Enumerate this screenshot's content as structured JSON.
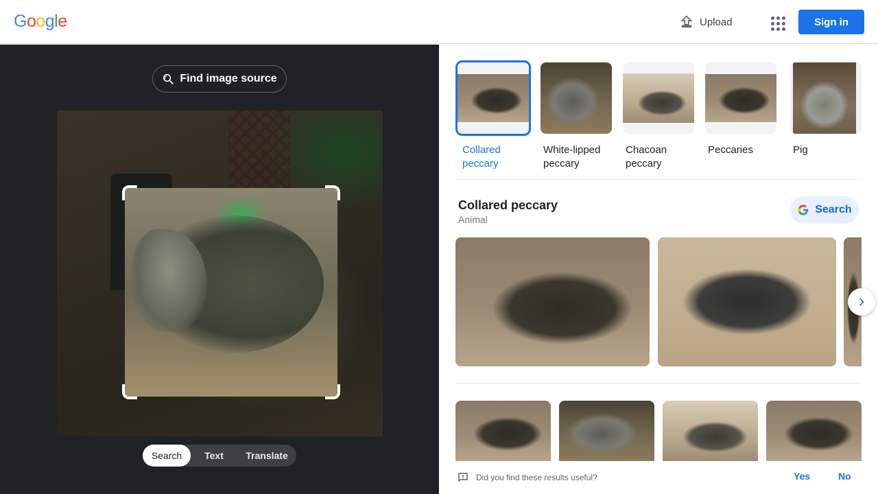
{
  "header": {
    "logo_letters": [
      "G",
      "o",
      "o",
      "g",
      "l",
      "e"
    ],
    "upload_label": "Upload",
    "signin_label": "Sign in"
  },
  "left": {
    "find_source_label": "Find image source",
    "modes": [
      "Search",
      "Text",
      "Translate"
    ],
    "active_mode": "Search"
  },
  "chips": [
    {
      "label": "Collared peccary",
      "selected": true
    },
    {
      "label": "White-lipped peccary",
      "selected": false
    },
    {
      "label": "Chacoan peccary",
      "selected": false
    },
    {
      "label": "Peccaries",
      "selected": false
    },
    {
      "label": "Pig",
      "selected": false
    }
  ],
  "knowledge": {
    "title": "Collared peccary",
    "subtitle": "Animal",
    "search_label": "Search"
  },
  "feedback": {
    "question": "Did you find these results useful?",
    "yes_label": "Yes",
    "no_label": "No"
  },
  "colors": {
    "accent": "#1a73e8",
    "dark_panel": "#202124",
    "search_pill": "#e8f0fe"
  }
}
